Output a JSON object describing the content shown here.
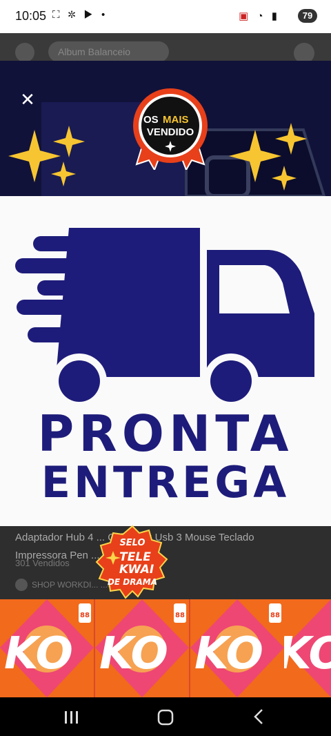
{
  "status_bar": {
    "time": "10:05",
    "left_icons": [
      "screenshot-icon",
      "pinwheel-icon",
      "youtube-icon",
      "dot-icon"
    ],
    "right_icons": [
      "cast-icon",
      "wifi-icon",
      "signal-icon"
    ],
    "battery": "79"
  },
  "background": {
    "title_line1": "Adaptador Hub 4 ... Cabo Otg Usb 3 Mouse Teclado",
    "title_line2": "Impressora Pen ... Hub",
    "sold": "301 Vendidos",
    "shop": "SHOP WORKDI... ...endar",
    "pill": "Album   Balanceio"
  },
  "ad": {
    "badge_line1a": "OS ",
    "badge_line1b": "MAIS",
    "badge_line2": "VENDIDO",
    "headline_1": "PRONTA",
    "headline_2": "ENTREGA"
  },
  "selo": {
    "line1": "SELO",
    "line2": "TELE",
    "line3": "KWAI",
    "line4": "DE DRAMA"
  },
  "banner": {
    "tile_text": "KO",
    "tile_sub": "88"
  },
  "colors": {
    "brand_blue": "#1e1c7a",
    "badge_red": "#e8401a",
    "banner_orange": "#f26a1b",
    "banner_pink": "#ec3f8a"
  }
}
